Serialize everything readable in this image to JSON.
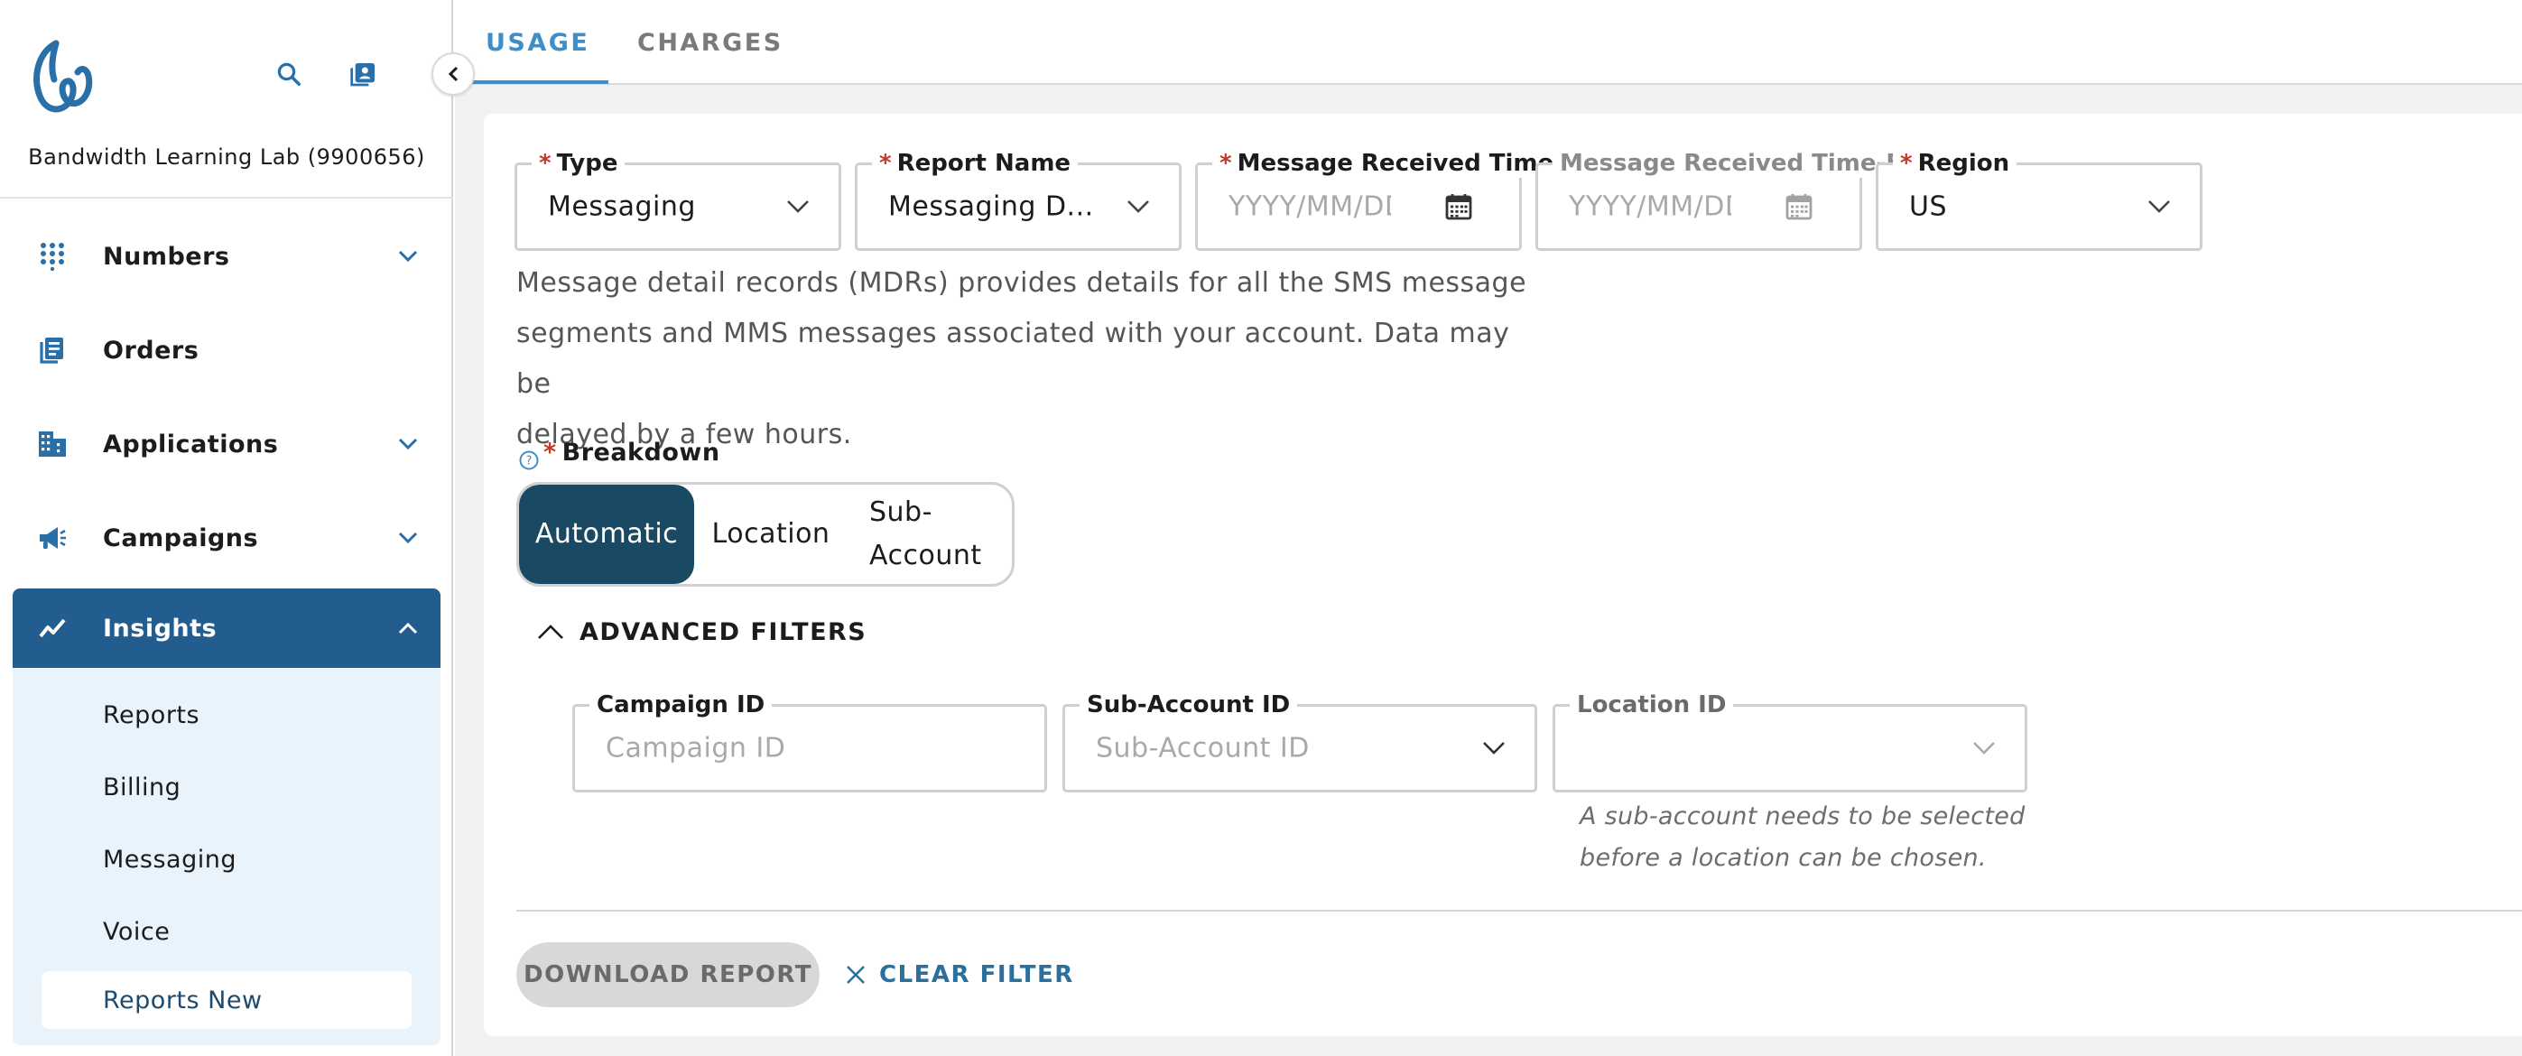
{
  "sidebar": {
    "account_name": "Bandwidth Learning Lab (9900656)",
    "items": [
      {
        "label": "Numbers",
        "icon": "keypad-icon"
      },
      {
        "label": "Orders",
        "icon": "receipt-icon"
      },
      {
        "label": "Applications",
        "icon": "building-icon"
      },
      {
        "label": "Campaigns",
        "icon": "megaphone-icon"
      },
      {
        "label": "Insights",
        "icon": "trend-line-icon"
      }
    ],
    "insights_subitems": [
      {
        "label": "Reports"
      },
      {
        "label": "Billing"
      },
      {
        "label": "Messaging"
      },
      {
        "label": "Voice"
      },
      {
        "label": "Reports New"
      }
    ]
  },
  "tabs": [
    {
      "label": "USAGE"
    },
    {
      "label": "CHARGES"
    }
  ],
  "form": {
    "type": {
      "label": "Type",
      "value": "Messaging"
    },
    "report_name": {
      "label": "Report Name",
      "value": "Messaging D..."
    },
    "time_start": {
      "label": "Message Received Time-Start",
      "placeholder": "YYYY/MM/DD"
    },
    "time_end": {
      "label": "Message Received Time-End",
      "placeholder": "YYYY/MM/DD"
    },
    "region": {
      "label": "Region",
      "value": "US"
    },
    "description_lines": [
      "Message detail records (MDRs) provides details for all the SMS message",
      "segments and MMS messages associated with your account. Data may be",
      "delayed by a few hours."
    ],
    "breakdown": {
      "label": "Breakdown",
      "options": [
        "Automatic",
        "Location",
        "Sub-",
        "Account"
      ],
      "selected": "Automatic"
    },
    "advanced_filters_label": "ADVANCED FILTERS",
    "campaign_id": {
      "label": "Campaign ID",
      "placeholder": "Campaign ID"
    },
    "sub_account_id": {
      "label": "Sub-Account ID",
      "placeholder": "Sub-Account ID"
    },
    "location_id": {
      "label": "Location ID"
    },
    "location_helper_lines": [
      "A sub-account needs to be selected",
      "before a location can be chosen."
    ],
    "download_label": "DOWNLOAD REPORT",
    "clear_label": "CLEAR FILTER"
  },
  "colors": {
    "accent": "#3e8fc9",
    "sidebar_active": "#235c8e",
    "segment_active": "#1a4a63",
    "subnav_bg": "#e8f3fb",
    "required": "#c0392b"
  }
}
